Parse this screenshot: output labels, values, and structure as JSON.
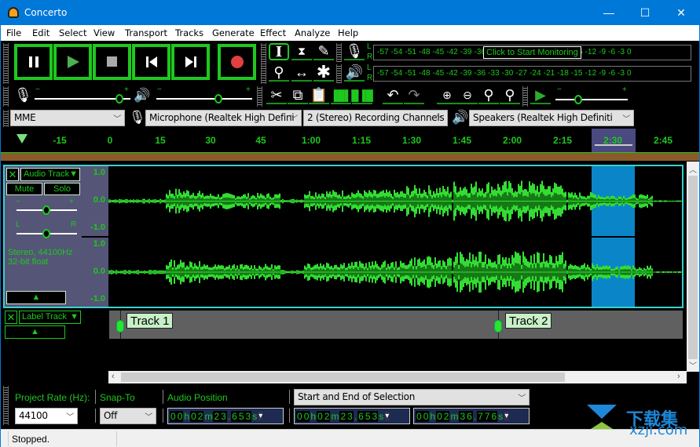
{
  "window": {
    "title": "Concerto",
    "minimize": "—",
    "maximize": "☐",
    "close": "✕"
  },
  "menu": [
    "File",
    "Edit",
    "Select",
    "View",
    "Transport",
    "Tracks",
    "Generate",
    "Effect",
    "Analyze",
    "Help"
  ],
  "transport": {
    "buttons": [
      "pause",
      "play",
      "stop",
      "skip-to-start",
      "skip-to-end",
      "record"
    ]
  },
  "tools": {
    "row1": [
      "selection-tool",
      "envelope-tool",
      "draw-tool"
    ],
    "row2": [
      "zoom-tool",
      "time-shift-tool",
      "multi-tool"
    ]
  },
  "meters": {
    "record_scale": "-57 -54 -51 -48 -45 -42 -39 -36 -33 -30 -27 -24 -21 -18 -15 -12 -9 -6 -3 0",
    "play_scale": "-57 -54 -51 -48 -45 -42 -39 -36 -33 -30 -27 -24 -21 -18 -15 -12 -9 -6 -3 0",
    "monitor_prompt": "Click to Start Monitoring",
    "left": "L",
    "right": "R"
  },
  "mixer": {
    "record_volume": 0.9,
    "playback_volume": 0.7,
    "minus": "−",
    "plus": "+"
  },
  "edit_tools": [
    "cut",
    "copy",
    "paste",
    "trim",
    "silence",
    "undo",
    "redo",
    "zoom-in",
    "zoom-out",
    "fit-selection",
    "fit-project"
  ],
  "play_at_speed": {
    "speed": 0.4
  },
  "device": {
    "host": "MME",
    "recording_device": "Microphone (Realtek High Defini",
    "channels": "2 (Stereo) Recording Channels",
    "playback_device": "Speakers (Realtek High Definiti"
  },
  "timeline": {
    "ticks": [
      "-15",
      "0",
      "15",
      "30",
      "45",
      "1:00",
      "1:15",
      "1:30",
      "1:45",
      "2:00",
      "2:15",
      "2:30",
      "2:45"
    ],
    "selected_tick": "2:30"
  },
  "audio_track": {
    "name": "Audio Track",
    "mute": "Mute",
    "solo": "Solo",
    "gain": 0.5,
    "pan": 0.5,
    "gain_minus": "−",
    "gain_plus": "+",
    "pan_left": "L",
    "pan_right": "R",
    "info_line1": "Stereo, 44100Hz",
    "info_line2": "32-bit float",
    "scale": [
      "1.0",
      "0.0",
      "-1.0"
    ],
    "selection_start": "00h02m23.653s",
    "selection_end": "00h02m36.776s"
  },
  "label_track": {
    "name": "Label Track",
    "labels": [
      {
        "text": "Track 1"
      },
      {
        "text": "Track 2"
      }
    ]
  },
  "selection_bar": {
    "project_rate_label": "Project Rate (Hz):",
    "project_rate": "44100",
    "snap_to_label": "Snap-To",
    "snap_to": "Off",
    "audio_position_label": "Audio Position",
    "audio_position": [
      "0",
      "0",
      "h",
      "0",
      "2",
      "m",
      "2",
      "3",
      ".",
      "6",
      "5",
      "3",
      "s"
    ],
    "selection_mode": "Start and End of Selection",
    "sel_start": [
      "0",
      "0",
      "h",
      "0",
      "2",
      "m",
      "2",
      "3",
      ".",
      "6",
      "5",
      "3",
      "s"
    ],
    "sel_end": [
      "0",
      "0",
      "h",
      "0",
      "2",
      "m",
      "3",
      "6",
      ".",
      "7",
      "7",
      "6",
      "s"
    ]
  },
  "status": {
    "text": "Stopped."
  },
  "watermark": {
    "text": "下载集",
    "url_text": "xzji.com"
  }
}
